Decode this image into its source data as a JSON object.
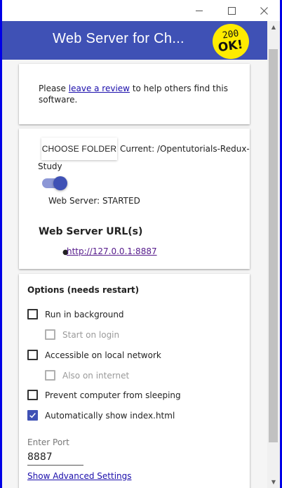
{
  "window": {
    "minimize_label": "–",
    "maximize_label": "☐",
    "close_label": "✕"
  },
  "header": {
    "title": "Web Server for Ch...",
    "badge_line1": "200",
    "badge_line2": "OK!",
    "background_color": "#3f51b5",
    "badge_color": "#ffeb00"
  },
  "review": {
    "before": "Please ",
    "link": "leave a review",
    "after": " to help others find this software."
  },
  "server": {
    "choose_folder_label": "CHOOSE FOLDER",
    "current_label": "Current: /Opentutorials-Redux-",
    "current_label_cont": "Study",
    "toggle_on": true,
    "status": "Web Server: STARTED",
    "urls_heading": "Web Server URL(s)",
    "urls": [
      "http://127.0.0.1:8887"
    ]
  },
  "options": {
    "heading": "Options (needs restart)",
    "items": [
      {
        "label": "Run in background",
        "checked": false,
        "disabled": false
      },
      {
        "label": "Start on login",
        "checked": false,
        "disabled": true
      },
      {
        "label": "Accessible on local network",
        "checked": false,
        "disabled": false
      },
      {
        "label": "Also on internet",
        "checked": false,
        "disabled": true
      },
      {
        "label": "Prevent computer from sleeping",
        "checked": false,
        "disabled": false
      },
      {
        "label": "Automatically show index.html",
        "checked": true,
        "disabled": false
      }
    ],
    "port_label": "Enter Port",
    "port_value": "8887",
    "advanced_link": "Show Advanced Settings"
  }
}
